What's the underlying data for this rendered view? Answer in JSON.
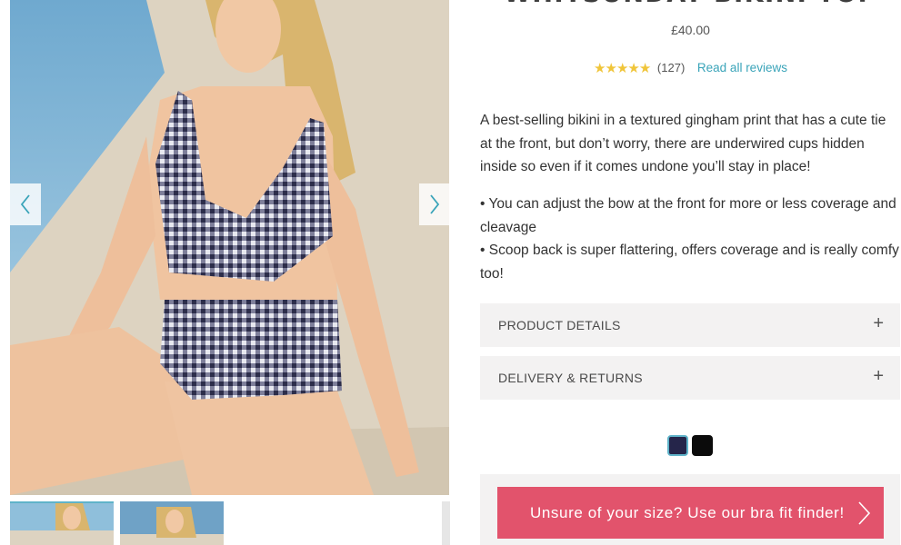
{
  "product": {
    "title": "WHITSUNDAY BIKINI TOP",
    "price": "£40.00",
    "rating": {
      "stars": "★★★★★",
      "value": 5,
      "count": "(127)",
      "read_reviews_label": "Read all reviews"
    },
    "description": "A best-selling bikini in a textured gingham print that has a cute tie at the front, but don’t worry, there are underwired cups hidden inside so even if it comes undone you’ll stay in place!",
    "bullets": [
      "• You can adjust the bow at the front for more or less coverage and cleavage",
      "• Scoop back is super flattering, offers coverage and is really comfy too!"
    ]
  },
  "accordions": [
    {
      "label": "PRODUCT DETAILS",
      "icon": "plus-icon",
      "symbol": "+"
    },
    {
      "label": "DELIVERY & RETURNS",
      "icon": "plus-icon",
      "symbol": "+"
    }
  ],
  "swatches": [
    {
      "name": "navy",
      "color": "#25254a",
      "selected": true
    },
    {
      "name": "black",
      "color": "#0b0b0b",
      "selected": false
    }
  ],
  "cta": {
    "label": "Unsure of your size? Use our bra fit finder!",
    "icon": "chevron-right-icon"
  },
  "gallery": {
    "prev_icon": "chevron-left-icon",
    "next_icon": "chevron-right-icon"
  },
  "colors": {
    "accent": "#3aa4b9",
    "cta": "#e2536c",
    "star": "#f0c53a",
    "accordion_bg": "#f3f2f2"
  }
}
